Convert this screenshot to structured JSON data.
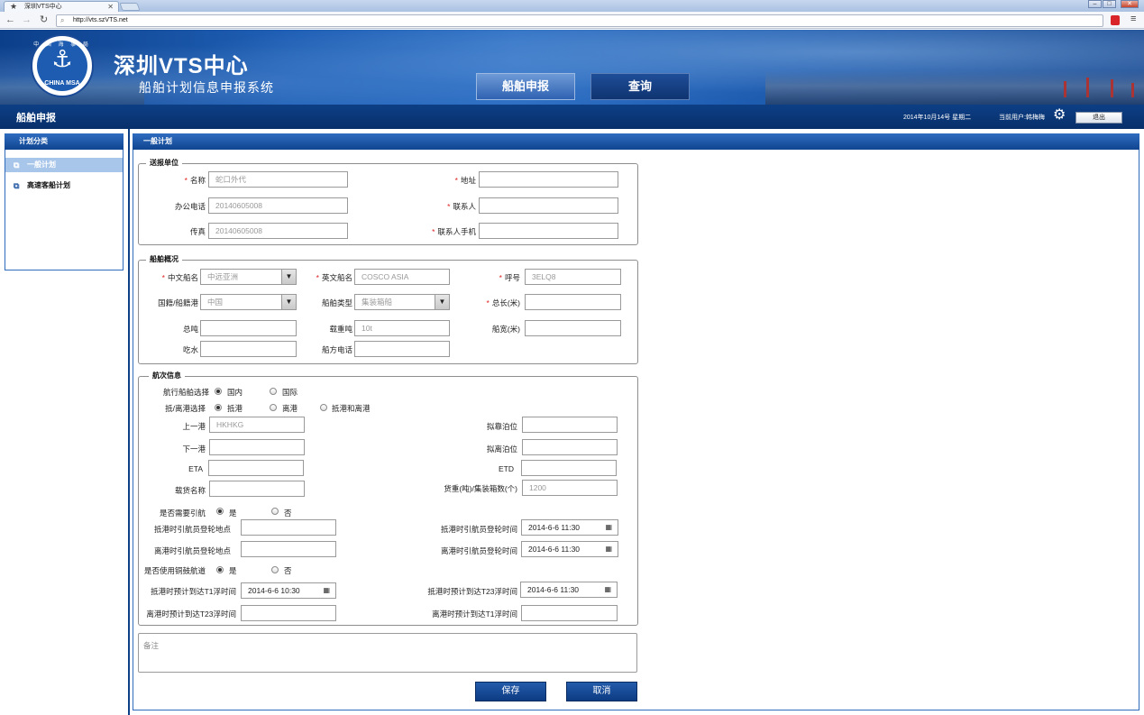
{
  "browser": {
    "tab_title": "深圳VTS中心",
    "url": "http://vts.szVTS.net",
    "tab_icon": "star-icon"
  },
  "header": {
    "title": "深圳VTS中心",
    "subtitle": "船舶计划信息申报系统",
    "logo_cn": "中 国 海 事 局",
    "logo_en": "CHINA MSA",
    "nav": [
      "船舶申报",
      "查询"
    ]
  },
  "titlebar": {
    "page_title": "船舶申报",
    "date": "2014年10月14号  星期二",
    "user": "当前用户:韩梅梅",
    "logout": "退出"
  },
  "sidebar": {
    "title": "计划分类",
    "items": [
      "一般计划",
      "高速客船计划"
    ]
  },
  "main": {
    "title": "一般计划",
    "sender": {
      "legend": "送报单位",
      "name_label": "名称",
      "name_value": "蛇口外代",
      "address_label": "地址",
      "address_value": "",
      "office_phone_label": "办公电话",
      "office_phone_value": "20140605008",
      "contact_label": "联系人",
      "contact_value": "",
      "fax_label": "传真",
      "fax_value": "20140605008",
      "mobile_label": "联系人手机",
      "mobile_value": ""
    },
    "ship": {
      "legend": "船舶概况",
      "cn_name_label": "中文船名",
      "cn_name_value": "中远亚洲",
      "en_name_label": "英文船名",
      "en_name_value": "COSCO ASIA",
      "callsign_label": "呼号",
      "callsign_value": "3ELQ8",
      "nationality_label": "国籍/船籍港",
      "nationality_value": "中国",
      "type_label": "船舶类型",
      "type_value": "集装箱船",
      "length_label": "总长(米)",
      "length_value": "",
      "gt_label": "总吨",
      "gt_value": "",
      "dwt_label": "载重吨",
      "dwt_value": "10t",
      "width_label": "船宽(米)",
      "width_value": "",
      "draft_label": "吃水",
      "draft_value": "",
      "phone_label": "船方电话",
      "phone_value": ""
    },
    "voyage": {
      "legend": "航次信息",
      "route_label": "航行船舶选择",
      "route_opts": [
        "国内",
        "国际"
      ],
      "arrdep_label": "抵/离港选择",
      "arrdep_opts": [
        "抵港",
        "离港",
        "抵港和离港"
      ],
      "prev_port_label": "上一港",
      "prev_port_value": "HKHKG",
      "berth_arr_label": "拟靠泊位",
      "berth_arr_value": "",
      "next_port_label": "下一港",
      "next_port_value": "",
      "berth_dep_label": "拟离泊位",
      "berth_dep_value": "",
      "eta_label": "ETA",
      "eta_value": "",
      "etd_label": "ETD",
      "etd_value": "",
      "cargo_label": "载货名称",
      "cargo_value": "",
      "weight_label": "货重(吨)/集装箱数(个)",
      "weight_value": "1200",
      "pilot_label": "是否需要引航",
      "yes": "是",
      "no": "否",
      "arr_pilot_place_label": "抵港时引航员登轮地点",
      "arr_pilot_place_value": "",
      "arr_pilot_time_label": "抵港时引航员登轮时间",
      "arr_pilot_time_value": "2014-6-6 11:30",
      "dep_pilot_place_label": "离港时引航员登轮地点",
      "dep_pilot_place_value": "",
      "dep_pilot_time_label": "离港时引航员登轮时间",
      "dep_pilot_time_value": "2014-6-6 11:30",
      "channel_label": "是否使用铜鼓航道",
      "arr_t1_label": "抵港时预计到达T1浮时间",
      "arr_t1_value": "2014-6-6 10:30",
      "arr_t23_label": "抵港时预计到达T23浮时间",
      "arr_t23_value": "2014-6-6 11:30",
      "dep_t23_label": "离港时预计到达T23浮时间",
      "dep_t23_value": "",
      "dep_t1_label": "离港时预计到达T1浮时间",
      "dep_t1_value": ""
    },
    "notes_placeholder": "备注",
    "save": "保存",
    "cancel": "取消"
  },
  "colors": {
    "primary": "#0f4590",
    "required": "#e02020"
  }
}
